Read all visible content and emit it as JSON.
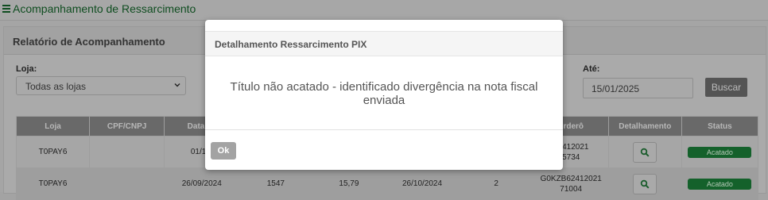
{
  "header": {
    "title": "Acompanhamento de Ressarcimento"
  },
  "panel": {
    "title": "Relatório de Acompanhamento"
  },
  "filters": {
    "store_label": "Loja:",
    "store_value": "Todas as lojas",
    "end_label": "Até:",
    "end_value": "15/01/2025",
    "search_label": "Buscar"
  },
  "table": {
    "headers": [
      "Loja",
      "CPF/CNPJ",
      "Data da",
      "",
      "",
      "",
      "",
      "orderô",
      "Detalhamento",
      "Status"
    ],
    "rows": [
      {
        "cells": [
          "T0PAY6",
          "",
          "01/10/",
          "",
          "",
          "",
          "",
          "62412021\n5734",
          "",
          ""
        ],
        "status": "Acatado"
      },
      {
        "cells": [
          "T0PAY6",
          "",
          "26/09/2024",
          "1547",
          "15,79",
          "26/10/2024",
          "2",
          "G0KZB62412021\n71004",
          "",
          ""
        ],
        "status": "Acatado"
      }
    ]
  },
  "modal": {
    "title": "Detalhamento Ressarcimento PIX",
    "message": "Título não acatado - identificado divergência na nota fiscal enviada",
    "ok_label": "Ok"
  },
  "colors": {
    "brand_green": "#0f4d20",
    "badge_green": "#14612b"
  },
  "icons": {
    "menu": "menu-icon",
    "chevron": "chevron-down-icon",
    "search": "search-icon"
  }
}
